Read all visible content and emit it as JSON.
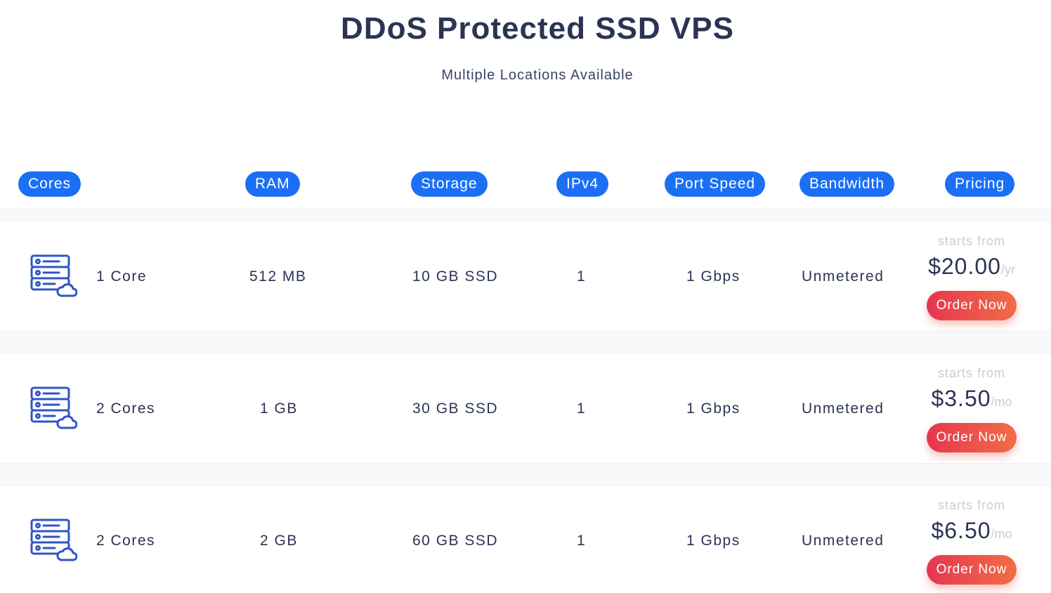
{
  "header": {
    "title": "DDoS Protected SSD VPS",
    "subtitle": "Multiple Locations Available"
  },
  "columns": [
    "Cores",
    "RAM",
    "Storage",
    "IPv4",
    "Port Speed",
    "Bandwidth",
    "Pricing"
  ],
  "plans": [
    {
      "icon": "server-cloud-icon",
      "cores": "1 Core",
      "ram": "512 MB",
      "storage": "10 GB SSD",
      "ipv4": "1",
      "port_speed": "1 Gbps",
      "bandwidth": "Unmetered",
      "starts_from": "starts from",
      "price": "$20.00",
      "period": "/yr",
      "order_label": "Order Now"
    },
    {
      "icon": "server-cloud-icon",
      "cores": "2 Cores",
      "ram": "1 GB",
      "storage": "30 GB SSD",
      "ipv4": "1",
      "port_speed": "1 Gbps",
      "bandwidth": "Unmetered",
      "starts_from": "starts from",
      "price": "$3.50",
      "period": "/mo",
      "order_label": "Order Now"
    },
    {
      "icon": "server-cloud-icon",
      "cores": "2 Cores",
      "ram": "2 GB",
      "storage": "60 GB SSD",
      "ipv4": "1",
      "port_speed": "1 Gbps",
      "bandwidth": "Unmetered",
      "starts_from": "starts from",
      "price": "$6.50",
      "period": "/mo",
      "order_label": "Order Now"
    }
  ],
  "colors": {
    "accent_blue": "#1a6ff5",
    "text_dark": "#2b3455",
    "order_gradient_start": "#e63650",
    "order_gradient_end": "#f26d45",
    "icon_blue": "#2f55c4"
  }
}
